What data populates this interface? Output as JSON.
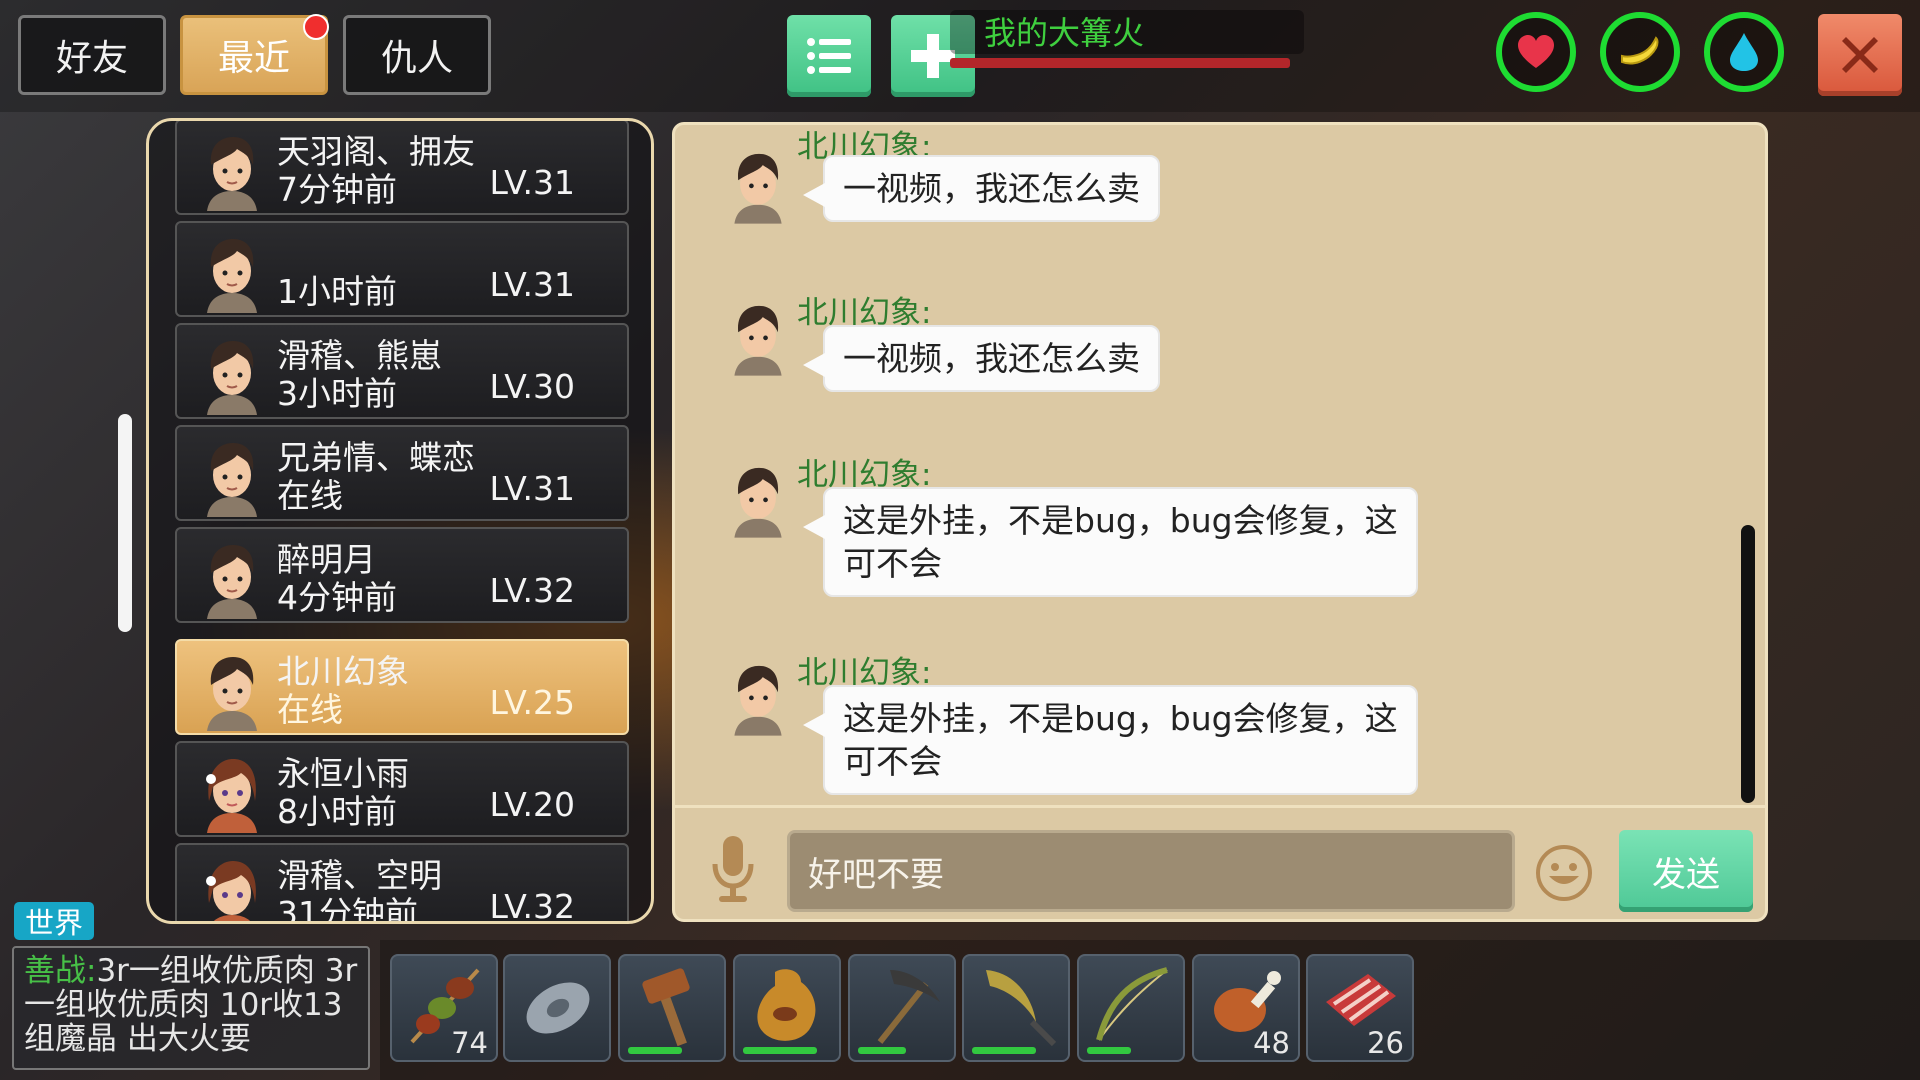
{
  "tabs": [
    {
      "label": "好友",
      "active": false
    },
    {
      "label": "最近",
      "active": true,
      "has_notification": true
    },
    {
      "label": "仇人",
      "active": false
    }
  ],
  "top": {
    "world_name": "我的大篝火",
    "menu_icon": "list-icon",
    "add_icon": "plus-icon",
    "status_icons": [
      "heart-icon",
      "banana-icon",
      "water-drop-icon"
    ],
    "close_icon": "close-icon"
  },
  "friends": [
    {
      "name": "天羽阁、拥友",
      "status": "7分钟前",
      "level": "LV.31",
      "gender": "male",
      "selected": false
    },
    {
      "name": "",
      "status": "1小时前",
      "level": "LV.31",
      "gender": "male",
      "selected": false
    },
    {
      "name": "滑稽、熊崽",
      "status": "3小时前",
      "level": "LV.30",
      "gender": "male",
      "selected": false
    },
    {
      "name": "兄弟情、蝶恋",
      "status": "在线",
      "level": "LV.31",
      "gender": "male",
      "selected": false
    },
    {
      "name": "醉明月",
      "status": "4分钟前",
      "level": "LV.32",
      "gender": "male",
      "selected": false
    },
    {
      "name": "北川幻象",
      "status": "在线",
      "level": "LV.25",
      "gender": "male",
      "selected": true
    },
    {
      "name": "永恒小雨",
      "status": "8小时前",
      "level": "LV.20",
      "gender": "female",
      "selected": false
    },
    {
      "name": "滑稽、空明",
      "status": "31分钟前",
      "level": "LV.32",
      "gender": "female",
      "selected": false
    }
  ],
  "chat": {
    "messages": [
      {
        "sender": "北川幻象:",
        "text_lines": [
          "一视频，我还怎么卖"
        ]
      },
      {
        "sender": "北川幻象:",
        "text_lines": [
          "一视频，我还怎么卖"
        ]
      },
      {
        "sender": "北川幻象:",
        "text_lines": [
          "这是外挂，不是bug，bug会修复，这",
          "可不会"
        ]
      },
      {
        "sender": "北川幻象:",
        "text_lines": [
          "这是外挂，不是bug，bug会修复，这",
          "可不会"
        ]
      }
    ],
    "input_value": "好吧不要",
    "send_label": "发送",
    "mic_icon": "microphone-icon",
    "emoji_icon": "smiley-icon"
  },
  "world_chat": {
    "tag": "世界",
    "sender": "善战",
    "separator": ":",
    "message": "3r一组收优质肉 3r一组收优质肉 10r收13组魔晶 出大火要"
  },
  "hotbar": [
    {
      "icon": "meat-skewer-icon",
      "count": "74"
    },
    {
      "icon": "stone-disc-icon",
      "count": ""
    },
    {
      "icon": "hammer-icon",
      "count": "",
      "durability": 0.55
    },
    {
      "icon": "water-pouch-icon",
      "count": "",
      "durability": 0.75
    },
    {
      "icon": "pickaxe-icon",
      "count": "",
      "durability": 0.5
    },
    {
      "icon": "sickle-icon",
      "count": "",
      "durability": 0.65
    },
    {
      "icon": "bow-icon",
      "count": "",
      "durability": 0.45
    },
    {
      "icon": "roast-drumstick-icon",
      "count": "48"
    },
    {
      "icon": "raw-meat-icon",
      "count": "26"
    }
  ],
  "colors": {
    "accent_green": "#3fc184",
    "selected_row": "#d9a253",
    "chat_bg": "#dcc9a4",
    "sender_green": "#2f7d2f",
    "status_ring": "#1edc32",
    "close_red": "#d9573b"
  }
}
